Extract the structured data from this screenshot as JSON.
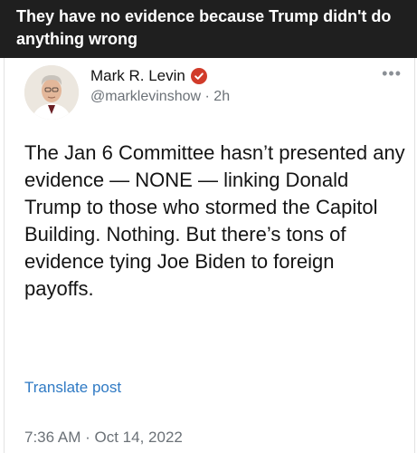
{
  "caption": {
    "text": "They have no evidence because Trump didn't do anything wrong"
  },
  "post": {
    "author_name": "Mark R. Levin",
    "handle": "@marklevinshow",
    "separator": "·",
    "time_ago": "2h",
    "more_icon": "•••",
    "body": "The Jan 6 Committee hasn’t presented any evidence — NONE — linking  Donald Trump to those who stormed the Capitol Building.  Nothing. But there’s tons of evidence tying Joe Biden to foreign payoffs.",
    "translate_label": "Translate post",
    "timestamp": "7:36 AM",
    "date": "Oct 14, 2022"
  },
  "colors": {
    "header_bg": "#1f1f1f",
    "verified_badge": "#d13b2a",
    "link": "#2f7ac4",
    "muted": "#6b7177"
  },
  "icons": {
    "verified": "verified-badge-icon",
    "more": "more-options-icon"
  }
}
